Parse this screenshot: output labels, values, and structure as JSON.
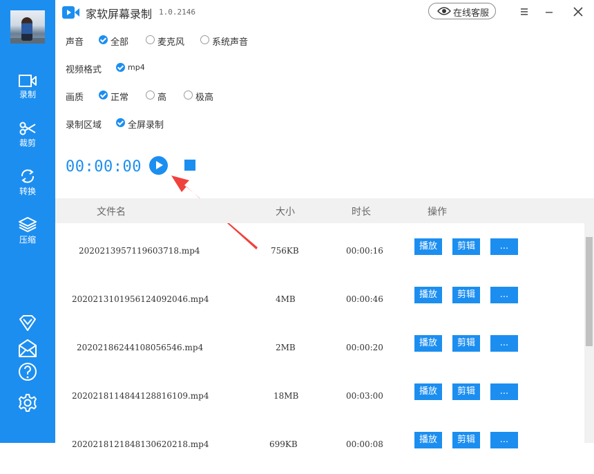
{
  "app": {
    "title": "家软屏幕录制",
    "version": "1.0.2146",
    "customer_service": "在线客服"
  },
  "sidebar": {
    "items": [
      {
        "label": "录制",
        "icon": "record-icon",
        "active": true
      },
      {
        "label": "裁剪",
        "icon": "scissors-icon"
      },
      {
        "label": "转换",
        "icon": "convert-icon"
      },
      {
        "label": "压缩",
        "icon": "compress-icon"
      }
    ],
    "bottom_icons": [
      "vip-diamond-icon",
      "mail-icon",
      "help-icon",
      "settings-icon"
    ]
  },
  "options": {
    "audio": {
      "label": "声音",
      "choices": [
        "全部",
        "麦克风",
        "系统声音"
      ],
      "selected": "全部"
    },
    "format": {
      "label": "视频格式",
      "choices": [
        "mp4"
      ],
      "selected": "mp4"
    },
    "quality": {
      "label": "画质",
      "choices": [
        "正常",
        "高",
        "极高"
      ],
      "selected": "正常"
    },
    "area": {
      "label": "录制区域",
      "choices": [
        "全屏录制"
      ],
      "selected": "全屏录制"
    }
  },
  "recorder": {
    "timer": "00:00:00"
  },
  "table": {
    "headers": {
      "name": "文件名",
      "size": "大小",
      "duration": "时长",
      "actions": "操作"
    },
    "action_labels": {
      "play": "播放",
      "edit": "剪辑",
      "more": "..."
    },
    "rows": [
      {
        "name": "2020213957119603718.mp4",
        "size": "756KB",
        "duration": "00:00:16"
      },
      {
        "name": "20202131019561240920​46.mp4",
        "size": "4MB",
        "duration": "00:00:46"
      },
      {
        "name": "2020218624410805 6546.mp4",
        "size": "2MB",
        "duration": "00:00:20"
      },
      {
        "name": "20202181148441288161 09.mp4",
        "size": "18MB",
        "duration": "00:03:00"
      },
      {
        "name": "20202181218481306202 18.mp4",
        "size": "699KB",
        "duration": "00:00:08"
      }
    ]
  },
  "colors": {
    "accent": "#1c8ef0",
    "header_bg": "#f1f1f1"
  }
}
